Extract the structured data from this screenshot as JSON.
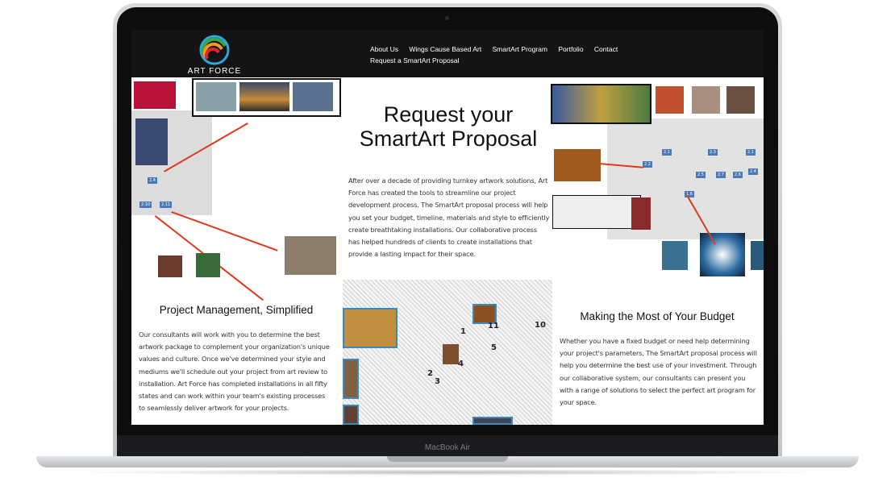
{
  "device": {
    "brand": "MacBook Air"
  },
  "site": {
    "logo_text": "ART FORCE",
    "nav": [
      "About Us",
      "Wings Cause Based Art",
      "SmartArt Program",
      "Portfolio",
      "Contact",
      "Request a SmartArt Proposal"
    ],
    "hero": {
      "title": "Request your SmartArt Proposal",
      "body": "After over a decade of providing turnkey artwork solutions, Art Force has created the tools to streamline our project development process. The SmartArt proposal process will help you set your budget, timeline, materials and style to efficiently create breathtaking installations. Our collaborative process has helped hundreds of clients to create installations that provide a lasting impact for their space."
    },
    "sections": [
      {
        "title": "Project Management, Simplified",
        "body": "Our consultants will work with you to determine the best artwork package to complement your organization's unique values and culture. Once we've determined your style and mediums we'll schedule out your project from art review to installation. Art Force has completed installations in all fifty states and can work within your team's existing processes to seamlessly deliver artwork for your projects."
      },
      {
        "title": "Making the Most of Your Budget",
        "body": "Whether you have a fixed budget or need help determining your project's parameters, The SmartArt proposal process will help you determine the best use of your investment. Through our collaborative system, our consultants can present you with a range of solutions to select the perfect art program for your space."
      }
    ],
    "plan_labels_left": [
      "2.4",
      "2.10",
      "2.11"
    ],
    "plan_labels_right": [
      "2.1",
      "2.2",
      "2.3",
      "2.1",
      "2.5",
      "2.6",
      "2.7",
      "2.4",
      "1.6"
    ],
    "plan_labels_center": [
      "1",
      "2",
      "3",
      "4",
      "5",
      "10",
      "11"
    ]
  }
}
